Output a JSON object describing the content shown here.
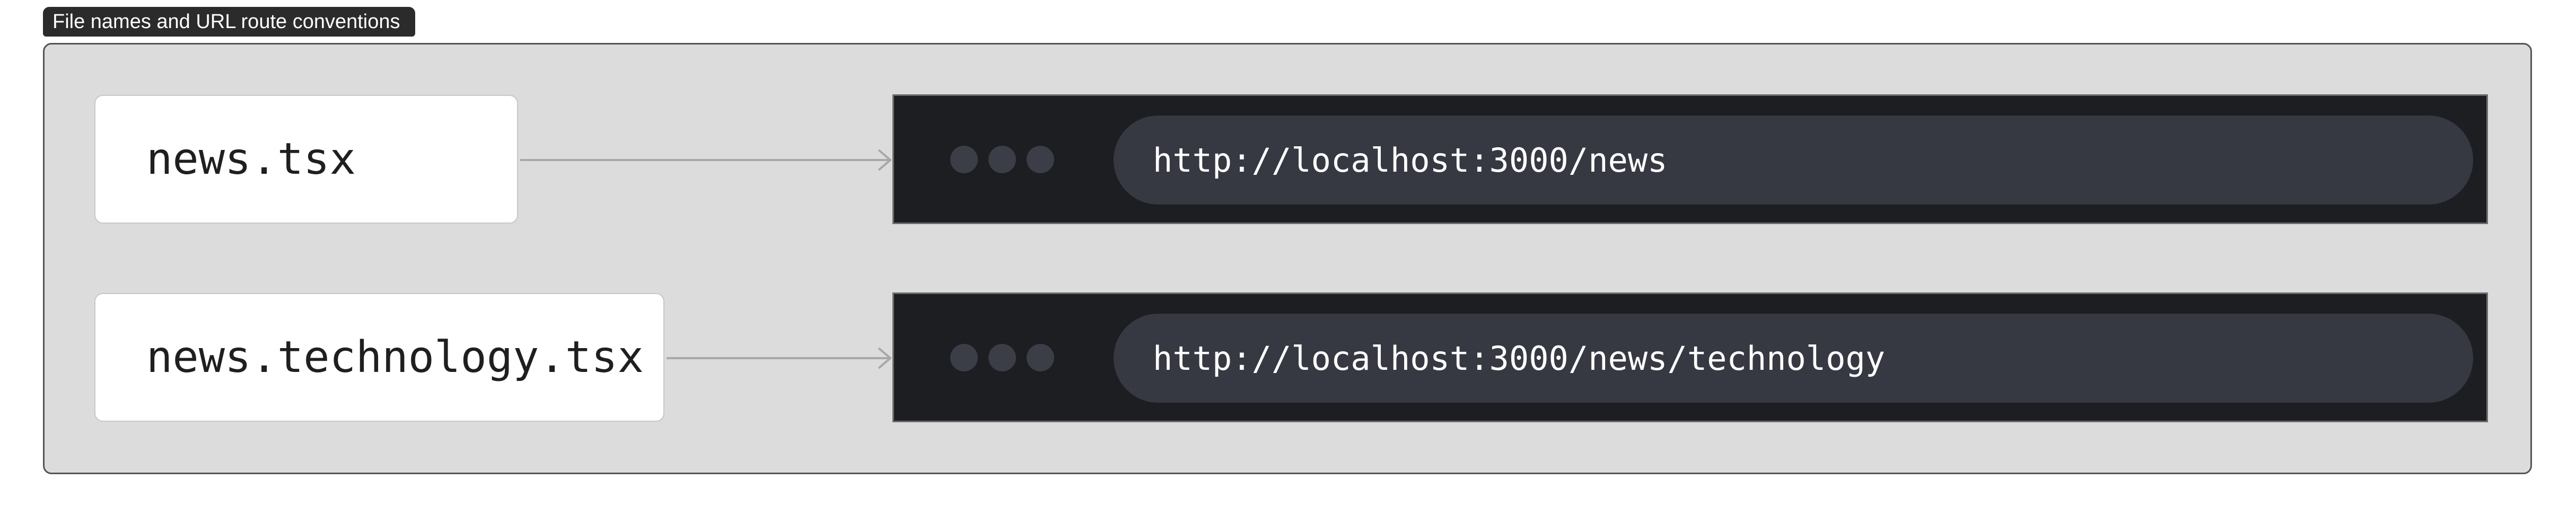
{
  "header": {
    "title": "File names and URL route conventions"
  },
  "rows": [
    {
      "file": "news.tsx",
      "url": "http://localhost:3000/news"
    },
    {
      "file": "news.technology.tsx",
      "url": "http://localhost:3000/news/technology"
    }
  ],
  "colors": {
    "panel_background": "#dcdcdc",
    "browser_background": "#1d1e22",
    "url_bar": "#373942",
    "window_dot": "#3b3d47",
    "arrow": "#a8a8a8"
  },
  "icons": {
    "window_controls": "window-dots-icon",
    "connector": "arrow-right-icon"
  }
}
